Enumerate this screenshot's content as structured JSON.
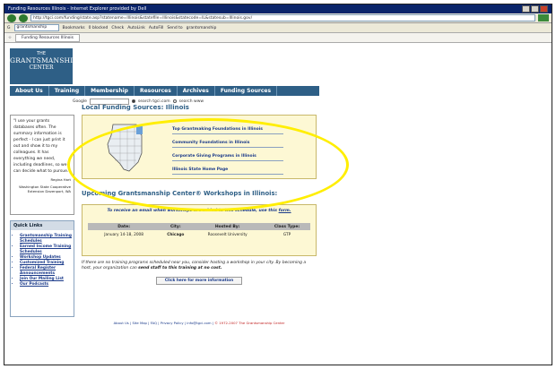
{
  "browser": {
    "window_title": "Funding Resources Illinois - Internet Explorer provided by Dell",
    "url": "http://tgci.com/funding/state.asp?statename=Illinois&statefile=Illinois&statecode=IL&statesub=Illinois.gov/",
    "toolbar_google": "grantsmanship",
    "toolbar_items": [
      "Bookmarks",
      "0 blocked",
      "Check",
      "AutoLink",
      "AutoFill",
      "Send to",
      "grantsmanship"
    ],
    "tab_label": "Funding Resources Illinois"
  },
  "site": {
    "logo_line1": "THE",
    "logo_line2": "GRANTSMANSHIP",
    "logo_line3": "CENTER",
    "nav": [
      "About Us",
      "Training",
      "Membership",
      "Resources",
      "Archives",
      "Funding Sources"
    ],
    "search": {
      "google_label": "Google",
      "option1": "search tgci.com",
      "option2": "search www"
    }
  },
  "sidebar": {
    "quote": "\"I use your grants databases often. The summary information is perfect - I can just print it out and show it to my colleagues. It has everything we need, including deadlines, so we can decide what to pursue.\"",
    "quote_attr_name": "Regina Hart",
    "quote_attr_org": "Washington State Cooperative Extension Davenport, WA",
    "quick_links_title": "Quick Links",
    "quick_links": [
      "Grantsmanship Training Schedules",
      "Earned Income Training Schedules",
      "Workshop Updates",
      "Customized Training",
      "Federal Register Announcements",
      "Join Our Mailing List",
      "Our Podcasts"
    ]
  },
  "main": {
    "local_heading": "Local Funding Sources: Illinois",
    "funding_links": [
      "Top Grantmaking Foundations in Illinois",
      "Community Foundations in Illinois",
      "Corporate Giving Programs in Illinois",
      "Illinois State Home Page"
    ],
    "upcoming_heading": "Upcoming Grantsmanship Center® Workshops in Illinois:",
    "notice_text": "To receive an email when workshops are added to this schedule, use this",
    "notice_link": "form.",
    "table_headers": [
      "Date:",
      "City:",
      "Hosted By:",
      "Class Type:"
    ],
    "table_rows": [
      [
        "January 14-18, 2008",
        "Chicago",
        "Roosevelt University",
        "GTP"
      ]
    ],
    "note_text": "If there are no training programs scheduled near you, consider hosting a workshop in your city. By becoming a host, your organization can",
    "note_bold": "send staff to this training at no cost.",
    "more_button": "Click here for more information"
  },
  "footer": {
    "links": "About Us | Site Map | FAQ | Privacy Policy | info@tgci.com |",
    "copyright": "© 1972-2007 The Grantsmanship Center"
  },
  "colors": {
    "brand_blue": "#2e5f86",
    "panel_bg": "#fdf8d4",
    "highlight_ellipse": "#ffee00"
  }
}
